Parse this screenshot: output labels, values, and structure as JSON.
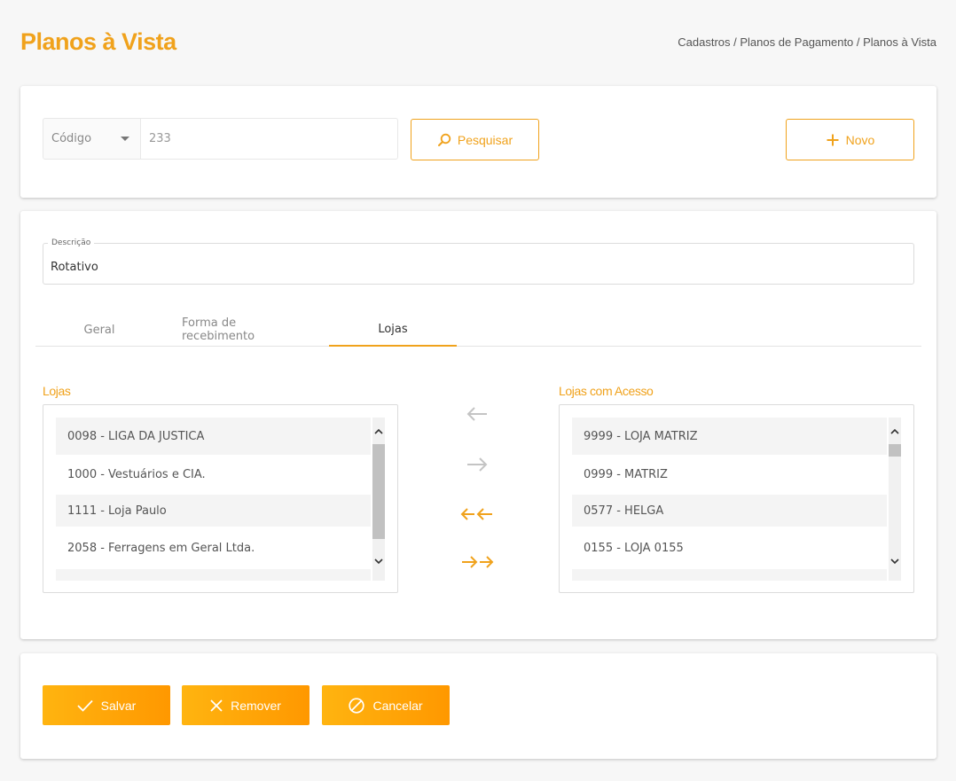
{
  "header": {
    "title": "Planos à Vista",
    "breadcrumb": "Cadastros / Planos de Pagamento / Planos à Vista"
  },
  "search": {
    "field_select": "Código",
    "value": "233",
    "search_label": "Pesquisar",
    "new_label": "Novo"
  },
  "form": {
    "description_label": "Descrição",
    "description_value": "Rotativo",
    "tabs": [
      {
        "label": "Geral",
        "active": false
      },
      {
        "label": "Forma de recebimento",
        "active": false
      },
      {
        "label": "Lojas",
        "active": true
      }
    ]
  },
  "stores": {
    "left_title": "Lojas",
    "right_title": "Lojas com Acesso",
    "left_items": [
      "0098 - LIGA DA JUSTICA",
      "1000 - Vestuários e CIA.",
      "1111 - Loja Paulo",
      "2058 - Ferragens em Geral Ltda."
    ],
    "right_items": [
      "9999 - LOJA MATRIZ",
      "0999 - MATRIZ",
      "0577 - HELGA",
      "0155 - LOJA 0155"
    ]
  },
  "actions": {
    "save_label": "Salvar",
    "remove_label": "Remover",
    "cancel_label": "Cancelar"
  },
  "colors": {
    "accent": "#f0a21c",
    "button_gradient_start": "#ffb410",
    "button_gradient_end": "#ff9800",
    "disabled_arrow": "#c4c4c4"
  }
}
